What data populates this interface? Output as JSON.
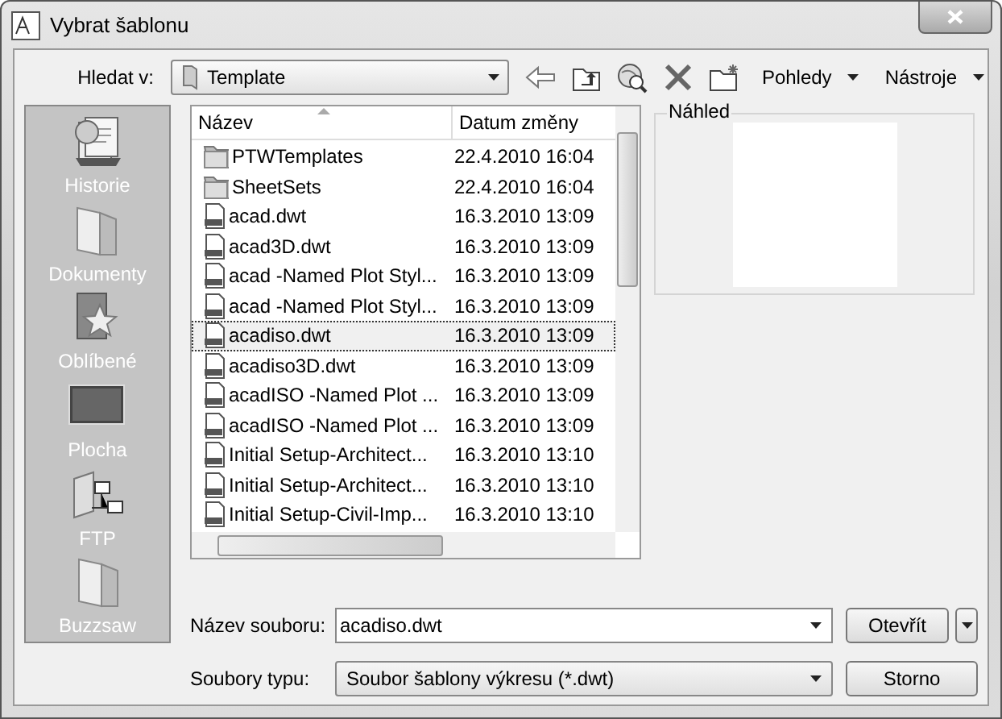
{
  "window": {
    "title": "Vybrat šablonu"
  },
  "toolbar": {
    "look_in_label": "Hledat v:",
    "location": "Template",
    "views": "Pohledy",
    "tools": "Nástroje"
  },
  "places": [
    {
      "label": "Historie",
      "kind": "history"
    },
    {
      "label": "Dokumenty",
      "kind": "folder"
    },
    {
      "label": "Oblíbené",
      "kind": "favorites"
    },
    {
      "label": "Plocha",
      "kind": "desktop"
    },
    {
      "label": "FTP",
      "kind": "network"
    },
    {
      "label": "Buzzsaw",
      "kind": "folder"
    }
  ],
  "file_list": {
    "columns": [
      "Název",
      "Datum změny"
    ],
    "rows": [
      {
        "name": "PTWTemplates",
        "date": "22.4.2010 16:04",
        "kind": "folder",
        "selected": false
      },
      {
        "name": "SheetSets",
        "date": "22.4.2010 16:04",
        "kind": "folder",
        "selected": false
      },
      {
        "name": "acad.dwt",
        "date": "16.3.2010 13:09",
        "kind": "dwt",
        "selected": false
      },
      {
        "name": "acad3D.dwt",
        "date": "16.3.2010 13:09",
        "kind": "dwt",
        "selected": false
      },
      {
        "name": "acad -Named Plot Styl...",
        "date": "16.3.2010 13:09",
        "kind": "dwt",
        "selected": false
      },
      {
        "name": "acad -Named Plot Styl...",
        "date": "16.3.2010 13:09",
        "kind": "dwt",
        "selected": false
      },
      {
        "name": "acadiso.dwt",
        "date": "16.3.2010 13:09",
        "kind": "dwt",
        "selected": true
      },
      {
        "name": "acadiso3D.dwt",
        "date": "16.3.2010 13:09",
        "kind": "dwt",
        "selected": false
      },
      {
        "name": "acadISO -Named Plot ...",
        "date": "16.3.2010 13:09",
        "kind": "dwt",
        "selected": false
      },
      {
        "name": "acadISO -Named Plot ...",
        "date": "16.3.2010 13:09",
        "kind": "dwt",
        "selected": false
      },
      {
        "name": "Initial Setup-Architect...",
        "date": "16.3.2010 13:10",
        "kind": "dwt",
        "selected": false
      },
      {
        "name": "Initial Setup-Architect...",
        "date": "16.3.2010 13:10",
        "kind": "dwt",
        "selected": false
      },
      {
        "name": "Initial Setup-Civil-Imp...",
        "date": "16.3.2010 13:10",
        "kind": "dwt",
        "selected": false
      }
    ]
  },
  "preview": {
    "label": "Náhled"
  },
  "file_name": {
    "label": "Název souboru:",
    "value": "acadiso.dwt"
  },
  "file_type": {
    "label": "Soubory typu:",
    "value": "Soubor šablony výkresu (*.dwt)"
  },
  "buttons": {
    "open": "Otevřít",
    "cancel": "Storno"
  }
}
